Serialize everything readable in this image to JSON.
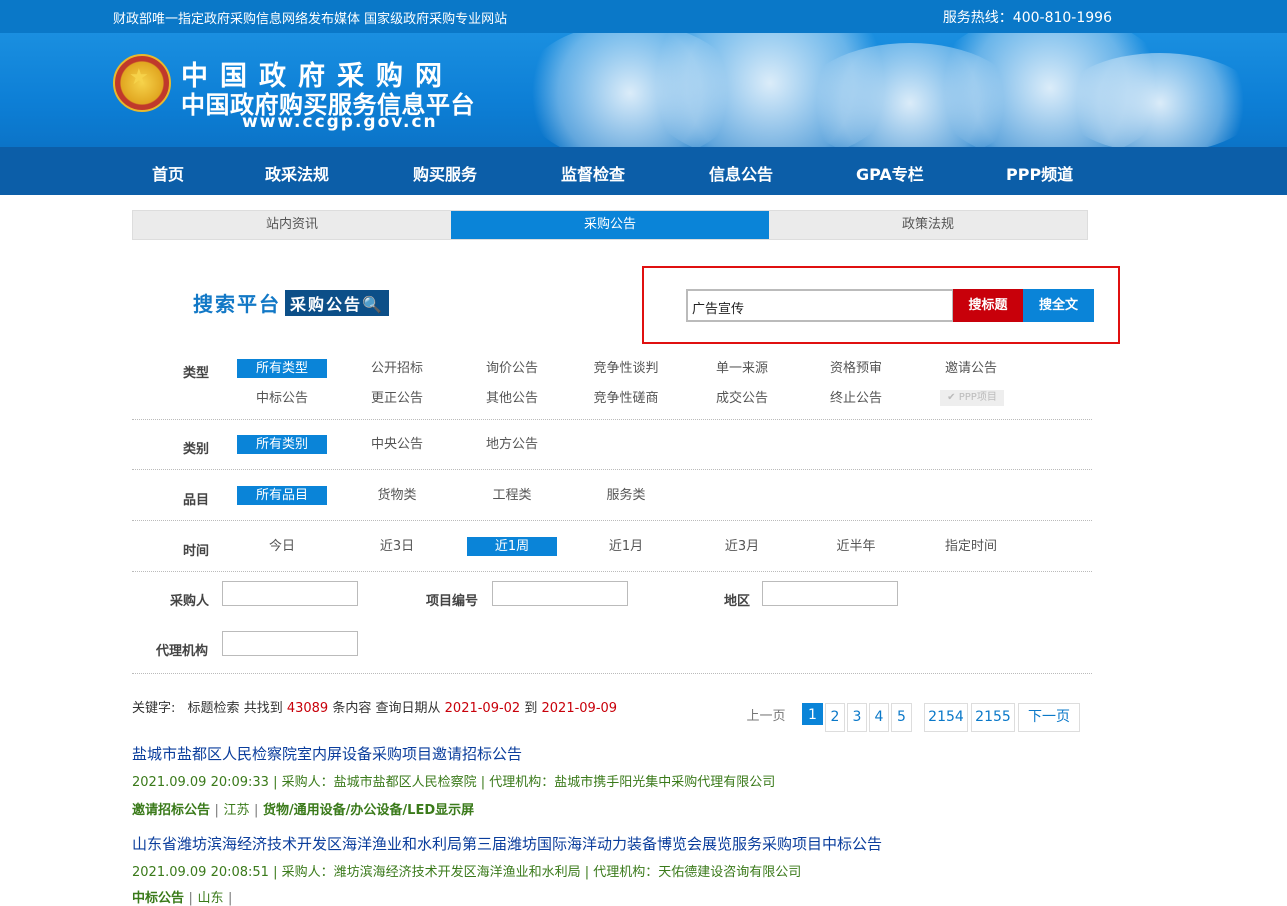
{
  "topbar": {
    "slogan": "财政部唯一指定政府采购信息网络发布媒体 国家级政府采购专业网站",
    "hotline": "服务热线：400-810-1996"
  },
  "logo": {
    "line1": "中国政府采购网",
    "line2": "中国政府购买服务信息平台",
    "line3": "www.ccgp.gov.cn"
  },
  "nav": {
    "items": [
      "首页",
      "政采法规",
      "购买服务",
      "监督检查",
      "信息公告",
      "GPA专栏",
      "PPP频道"
    ]
  },
  "subtabs": [
    "站内资讯",
    "采购公告",
    "政策法规"
  ],
  "search": {
    "logo_text": "搜索平台",
    "logo_badge": "采购公告",
    "query": "广告宣传",
    "btn_title": "搜标题",
    "btn_full": "搜全文"
  },
  "filters": {
    "type_label": "类型",
    "type_options": [
      "所有类型",
      "公开招标",
      "询价公告",
      "竞争性谈判",
      "单一来源",
      "资格预审",
      "邀请公告",
      "中标公告",
      "更正公告",
      "其他公告",
      "竞争性磋商",
      "成交公告",
      "终止公告",
      "✔ PPP项目"
    ],
    "category_label": "类别",
    "category_options": [
      "所有类别",
      "中央公告",
      "地方公告"
    ],
    "item_label": "品目",
    "item_options": [
      "所有品目",
      "货物类",
      "工程类",
      "服务类"
    ],
    "time_label": "时间",
    "time_options": [
      "今日",
      "近3日",
      "近1周",
      "近1月",
      "近3月",
      "近半年",
      "指定时间"
    ],
    "buyer_label": "采购人",
    "project_label": "项目编号",
    "region_label": "地区",
    "agency_label": "代理机构"
  },
  "stats": {
    "keyword_label": "关键字:",
    "mode": "标题检索",
    "found_prefix": "共找到",
    "count": "43089",
    "found_suffix": "条内容",
    "date_prefix": "查询日期从",
    "date_from": "2021-09-02",
    "date_to_label": "到",
    "date_to": "2021-09-09"
  },
  "pagination": {
    "prev": "上一页",
    "pages": [
      "1",
      "2",
      "3",
      "4",
      "5"
    ],
    "tail_pages": [
      "2154",
      "2155"
    ],
    "next": "下一页"
  },
  "results": [
    {
      "title": "盐城市盐都区人民检察院室内屏设备采购项目邀请招标公告",
      "meta": "2021.09.09 20:09:33 | 采购人：盐城市盐都区人民检察院 | 代理机构：盐城市携手阳光集中采购代理有限公司",
      "tag_type": "邀请招标公告",
      "tag_region": "江苏",
      "tag_category": "货物/通用设备/办公设备/LED显示屏"
    },
    {
      "title": "山东省潍坊滨海经济技术开发区海洋渔业和水利局第三届潍坊国际海洋动力装备博览会展览服务采购项目中标公告",
      "meta": "2021.09.09 20:08:51 | 采购人：潍坊滨海经济技术开发区海洋渔业和水利局 | 代理机构：天佑德建设咨询有限公司",
      "tag_type": "中标公告",
      "tag_region": "山东",
      "tag_category": ""
    }
  ]
}
